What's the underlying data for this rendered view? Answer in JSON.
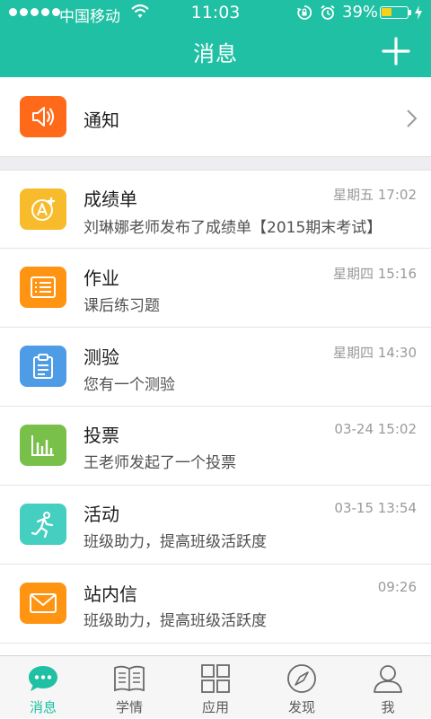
{
  "status_bar": {
    "carrier": "中国移动",
    "time": "11:03",
    "battery_percent": "39%",
    "battery_level": 0.39
  },
  "header": {
    "title": "消息",
    "add_icon": "plus-icon"
  },
  "colors": {
    "brand": "#1fc0a3",
    "notice": "#ff6a1a",
    "grades": "#f8bb2b",
    "homework": "#ff9312",
    "quiz": "#4e9be6",
    "vote": "#79c04b",
    "activity": "#45cfc0",
    "mail": "#ff9312"
  },
  "notice": {
    "name": "通知",
    "icon": "speaker-icon"
  },
  "messages": [
    {
      "name": "成绩单",
      "subtitle": "刘琳娜老师发布了成绩单【2015期末考试】",
      "time": "星期五  17:02",
      "icon": "grade-a-plus-icon"
    },
    {
      "name": "作业",
      "subtitle": "课后练习题",
      "time": "星期四  15:16",
      "icon": "homework-list-icon"
    },
    {
      "name": "测验",
      "subtitle": "您有一个测验",
      "time": "星期四  14:30",
      "icon": "clipboard-icon"
    },
    {
      "name": "投票",
      "subtitle": "王老师发起了一个投票",
      "time": "03-24  15:02",
      "icon": "bar-chart-icon"
    },
    {
      "name": "活动",
      "subtitle": "班级助力，提高班级活跃度",
      "time": "03-15  13:54",
      "icon": "running-person-icon"
    },
    {
      "name": "站内信",
      "subtitle": "班级助力，提高班级活跃度",
      "time": "09:26",
      "icon": "envelope-icon"
    }
  ],
  "tabs": [
    {
      "label": "消息",
      "icon": "chat-bubble-icon",
      "active": true
    },
    {
      "label": "学情",
      "icon": "open-book-icon",
      "active": false
    },
    {
      "label": "应用",
      "icon": "grid-icon",
      "active": false
    },
    {
      "label": "发现",
      "icon": "compass-icon",
      "active": false
    },
    {
      "label": "我",
      "icon": "user-icon",
      "active": false
    }
  ]
}
